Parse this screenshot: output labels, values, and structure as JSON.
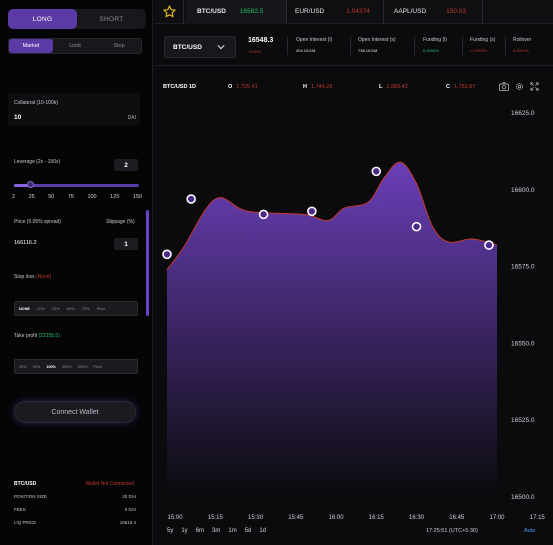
{
  "trade_panel": {
    "mode_tabs": [
      "LONG",
      "SHORT"
    ],
    "order_tabs": [
      "Market",
      "Limit",
      "Stop"
    ],
    "collateral": {
      "label": "Collateral (10-100k)",
      "value": "10",
      "unit": "DAI"
    },
    "leverage": {
      "label": "Leverage (2x - 150x)",
      "value": "2",
      "fraction": 0.13,
      "ticks": [
        "2",
        "25",
        "50",
        "75",
        "100",
        "125",
        "150"
      ]
    },
    "price": {
      "label": "Price (0.05% spread)",
      "value": "166116.2"
    },
    "slippage": {
      "label": "Slippage (%)",
      "value": "1"
    },
    "stop_loss": {
      "label": "Stop loss",
      "state": "(None)",
      "options": [
        "NONE",
        "-10%",
        "-25%",
        "-50%",
        "-75%",
        "-Price"
      ]
    },
    "take_profit": {
      "label": "Take profit",
      "value": "(22155.5)",
      "options": [
        "25%",
        "50%",
        "100%",
        "300%",
        "900%",
        "Price"
      ]
    },
    "connect_label": "Connect Wallet",
    "summary": {
      "pair": "BTC/USD",
      "wallet_state": "Wallet Not Connected",
      "rows": [
        {
          "label": "POSITION SIZE",
          "value": "20 DAI"
        },
        {
          "label": "FEES",
          "value": "0 DAI"
        },
        {
          "label": "LIQ PRICE",
          "value": "16616.4"
        }
      ]
    }
  },
  "tickers": [
    {
      "symbol": "BTC/USD",
      "price": "16582.5",
      "color": "#23c36b"
    },
    {
      "symbol": "EUR/USD",
      "price": "1.04374",
      "color": "#c0392b"
    },
    {
      "symbol": "AAPL/USD",
      "price": "150.03",
      "color": "#c0392b"
    }
  ],
  "market": {
    "pair": "BTC/USD",
    "last_price": "16548.3",
    "last_change": "-0.26%",
    "stats": [
      {
        "title": "Open Interest (l)",
        "value": "404.1K/1M"
      },
      {
        "title": "Open Interest (s)",
        "value": "738.1K/1M"
      },
      {
        "title": "Funding (l)",
        "value": "0.0006%"
      },
      {
        "title": "Funding (s)",
        "value": "-0.0003%"
      },
      {
        "title": "Rollover",
        "value": "0.0001%"
      }
    ]
  },
  "chart_header": {
    "symbol": "BTC/USD 1D",
    "o_label": "O",
    "o": "1,725.41",
    "h_label": "H",
    "h": "1,744.26",
    "l_label": "L",
    "l": "1,689.42",
    "c_label": "C",
    "c": "1,752.87"
  },
  "timeframes": [
    "5y",
    "1y",
    "6m",
    "3m",
    "1m",
    "5d",
    "1d"
  ],
  "time_readout": "17:25:51 (UTC+5:30)",
  "scale_mode": "Auto",
  "colors": {
    "accent": "#5b3aa6",
    "up": "#23c36b",
    "down": "#c0392b"
  },
  "chart_data": {
    "type": "area",
    "title": "BTC/USD 1D",
    "x": [
      "14:57",
      "15:03",
      "15:15",
      "15:27",
      "15:48",
      "15:57",
      "16:03",
      "16:12",
      "16:18",
      "16:24",
      "16:30",
      "16:36",
      "16:42",
      "16:51",
      "17:00"
    ],
    "y": [
      16574,
      16581,
      16597,
      16593,
      16592,
      16590,
      16594,
      16596,
      16604,
      16609,
      16602,
      16588,
      16583,
      16584,
      16582
    ],
    "markers": [
      {
        "x": "14:57",
        "y": 16579
      },
      {
        "x": "15:06",
        "y": 16597
      },
      {
        "x": "15:33",
        "y": 16592
      },
      {
        "x": "15:51",
        "y": 16593
      },
      {
        "x": "16:15",
        "y": 16606
      },
      {
        "x": "16:30",
        "y": 16588
      },
      {
        "x": "16:57",
        "y": 16582
      }
    ],
    "xticks": [
      "15:00",
      "15:15",
      "15:30",
      "15:45",
      "16:00",
      "16:15",
      "16:30",
      "16:45",
      "17:00",
      "17:15"
    ],
    "yticks": [
      16500,
      16525,
      16550,
      16575,
      16600,
      16625
    ],
    "ylim": [
      16500,
      16625
    ],
    "fill_top": "#6a3fb8",
    "fill_bottom": "#0b0b0d",
    "line_color": "#c0392b"
  }
}
